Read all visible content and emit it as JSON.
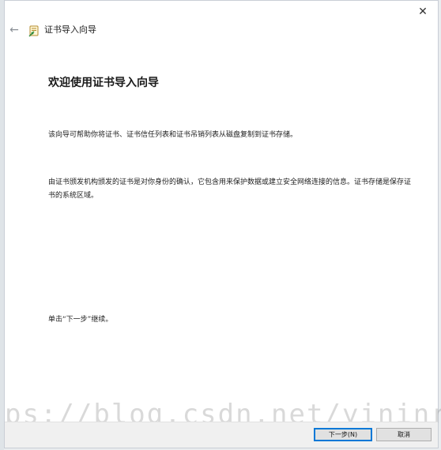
{
  "window": {
    "close_symbol": "✕"
  },
  "header": {
    "back_symbol": "←",
    "icon": "certificate-icon",
    "title": "证书导入向导"
  },
  "main": {
    "heading": "欢迎使用证书导入向导",
    "paragraph1": "该向导可帮助你将证书、证书信任列表和证书吊销列表从磁盘复制到证书存储。",
    "paragraph2": "由证书颁发机构颁发的证书是对你身份的确认，它包含用来保护数据或建立安全网络连接的信息。证书存储是保存证书的系统区域。",
    "paragraph3": "单击“下一步”继续。"
  },
  "footer": {
    "next_label": "下一步(N)",
    "cancel_label": "取消"
  },
  "watermark": {
    "text": "ps://blog.csdn.net/yininrfr"
  },
  "colors": {
    "accent": "#0078d7",
    "footer_bg": "#f0f0f0"
  }
}
